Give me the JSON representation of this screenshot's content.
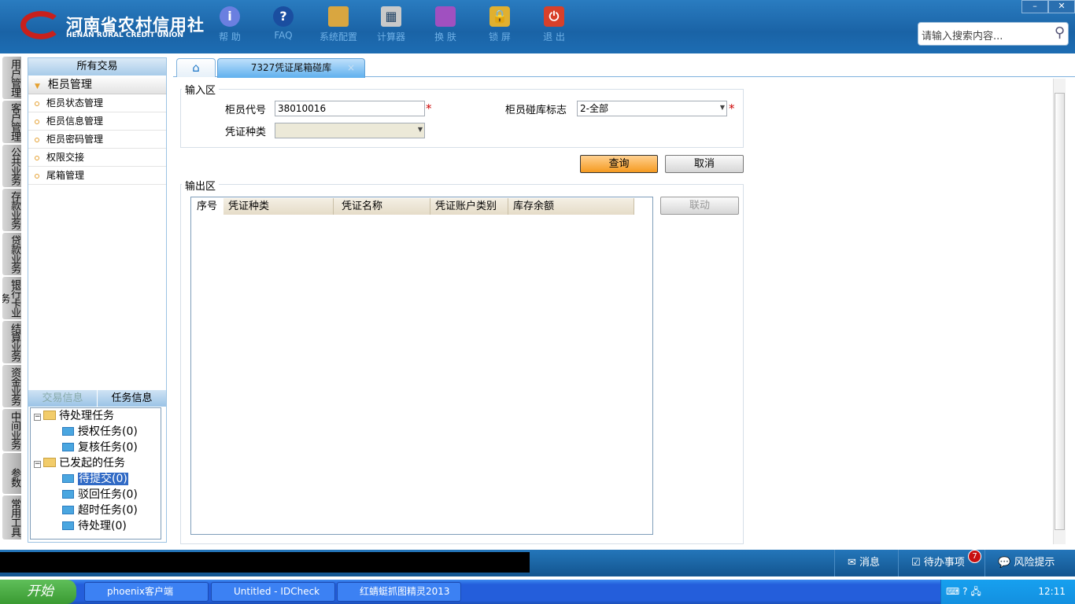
{
  "header": {
    "logo_cn": "河南省农村信用社",
    "logo_en": "HENAN RURAL CREDIT UNION",
    "tools": [
      {
        "label": "帮 助",
        "icon": "info-icon"
      },
      {
        "label": "FAQ",
        "icon": "question-icon"
      },
      {
        "label": "系统配置",
        "icon": "toolbox-icon"
      },
      {
        "label": "计算器",
        "icon": "calculator-icon"
      },
      {
        "label": "换 肤",
        "icon": "shirt-icon"
      },
      {
        "label": "锁 屏",
        "icon": "lock-icon"
      },
      {
        "label": "退 出",
        "icon": "power-icon"
      }
    ],
    "search_placeholder": "请输入搜索内容...",
    "min": "–",
    "close": "✕"
  },
  "vtabs": [
    "用户管理",
    "客户管理",
    "公共业务",
    "存款业务",
    "贷款业务",
    "银行卡业务",
    "结算业务",
    "资金业务",
    "中间业务",
    "参数",
    "常用工具"
  ],
  "left": {
    "title": "所有交易",
    "group": "柜员管理",
    "items": [
      "柜员状态管理",
      "柜员信息管理",
      "柜员密码管理",
      "权限交接",
      "尾箱管理"
    ],
    "tabs": [
      "交易信息",
      "任务信息"
    ],
    "tree": {
      "pending": "待处理任务",
      "pending_children": [
        "授权任务(0)",
        "复核任务(0)"
      ],
      "initiated": "已发起的任务",
      "initiated_children": [
        "待提交(0)",
        "驳回任务(0)",
        "超时任务(0)",
        "待处理(0)"
      ]
    }
  },
  "tabs": {
    "active": "7327凭证尾箱碰库"
  },
  "form": {
    "input_legend": "输入区",
    "teller_code_label": "柜员代号",
    "teller_code": "38010016",
    "flag_label": "柜员碰库标志",
    "flag_value": "2-全部",
    "voucher_type_label": "凭证种类",
    "voucher_type": "",
    "query": "查询",
    "cancel": "取消",
    "output_legend": "输出区",
    "link": "联动",
    "columns": [
      "序号",
      "凭证种类",
      "凭证名称",
      "凭证账户类别",
      "库存余额"
    ]
  },
  "status": {
    "message": "消息",
    "todo": "待办事项",
    "todo_count": "7",
    "risk": "风险提示"
  },
  "taskbar": {
    "start": "开始",
    "tasks": [
      "phoenix客户端",
      "Untitled - IDCheck",
      "红蜻蜓抓图精灵2013"
    ],
    "clock": "12:11"
  }
}
